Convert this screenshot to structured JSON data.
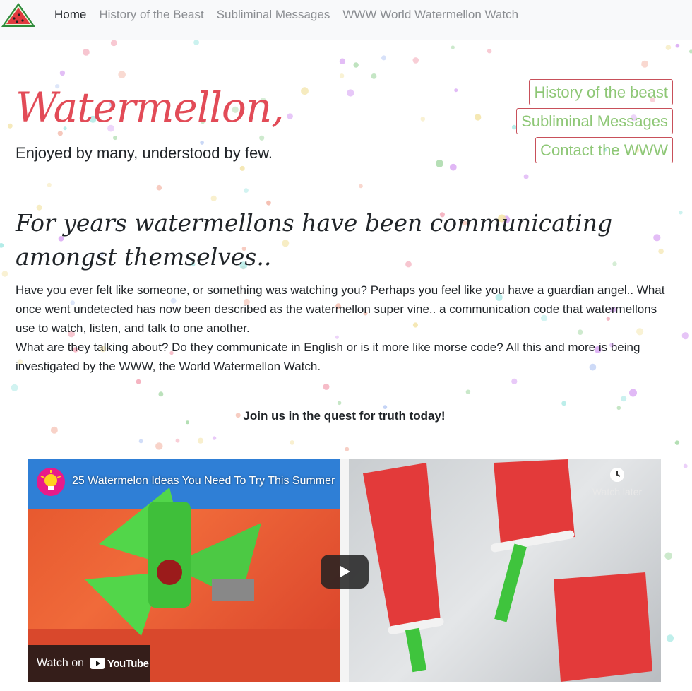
{
  "nav": {
    "logo_icon": "watermelon-slice-icon",
    "links": [
      {
        "label": "Home",
        "active": true
      },
      {
        "label": "History of the Beast",
        "active": false
      },
      {
        "label": "Subliminal Messages",
        "active": false
      },
      {
        "label": "WWW World Watermellon Watch",
        "active": false
      }
    ]
  },
  "hero": {
    "title": "Watermellon,",
    "tagline": "Enjoyed by many, understood by few."
  },
  "side_buttons": [
    {
      "label": "History of the beast"
    },
    {
      "label": "Subliminal Messages"
    },
    {
      "label": "Contact the WWW"
    }
  ],
  "content": {
    "headline": "For years watermellons have been communicating amongst themselves..",
    "paragraphs": [
      "Have you ever felt like someone, or something was watching you? Perhaps you feel like you have a guardian angel.. What once went undetected has now been described as the watermellon super vine.. a communication code that watermellons use to watch, listen, and talk to one another.",
      "What are they talking about? Do they communicate in English or is it more like morse code? All this and more is being investigated by the WWW, the World Watermellon Watch."
    ],
    "cta": "Join us in the quest for truth today!"
  },
  "video": {
    "title": "25 Watermelon Ideas You Need To Try This Summer",
    "watch_later": "Watch later",
    "watch_on": "Watch on",
    "youtube": "YouTube",
    "icons": {
      "channel": "lightbulb-avatar-icon",
      "watch_later": "clock-icon",
      "play": "play-icon",
      "youtube": "youtube-logo-icon"
    }
  },
  "colors": {
    "title_red": "#e24b57",
    "button_border": "#c8505a",
    "button_text": "#8ec776",
    "navbar_bg": "#f8f9fa"
  }
}
